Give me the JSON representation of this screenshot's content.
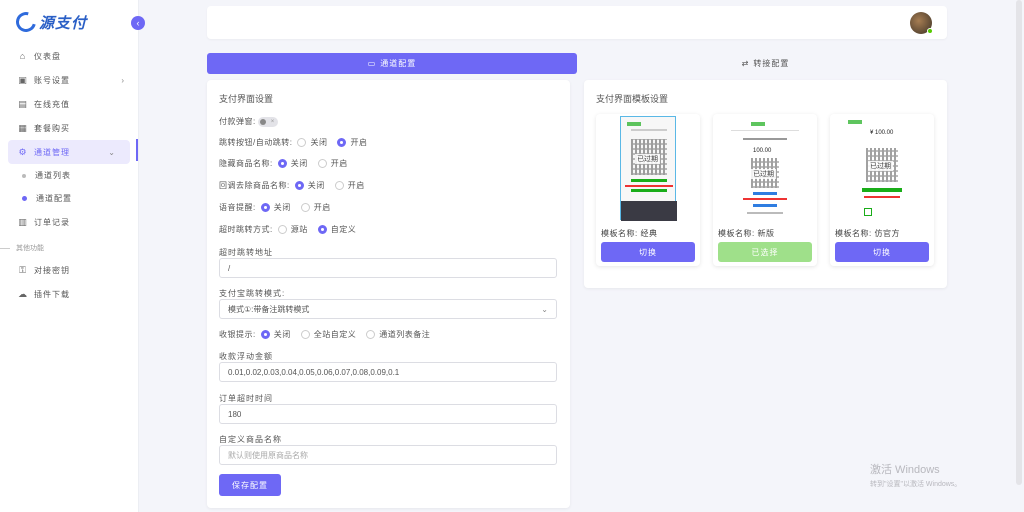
{
  "brand": {
    "logo_text": "源支付"
  },
  "sidebar": {
    "items": [
      {
        "label": "仪表盘",
        "icon": "home-icon"
      },
      {
        "label": "账号设置",
        "icon": "user-card-icon"
      },
      {
        "label": "在线充值",
        "icon": "wallet-icon"
      },
      {
        "label": "套餐购买",
        "icon": "package-icon"
      },
      {
        "label": "通道管理",
        "icon": "gear-icon"
      }
    ],
    "sub_items": [
      {
        "label": "通道列表"
      },
      {
        "label": "通道配置"
      }
    ],
    "order_item": {
      "label": "订单记录",
      "icon": "order-icon"
    },
    "group_label": "其他功能",
    "other_items": [
      {
        "label": "对接密钥",
        "icon": "key-icon"
      },
      {
        "label": "插件下载",
        "icon": "cloud-download-icon"
      }
    ]
  },
  "tabs": [
    {
      "label": "通道配置",
      "icon": "monitor-icon",
      "active": true
    },
    {
      "label": "转接配置",
      "icon": "swap-icon",
      "active": false
    }
  ],
  "payment_settings": {
    "title": "支付界面设置",
    "popup_label": "付款弹窗:",
    "jump_label": "跳转按钮/自动跳转:",
    "hide_name_label": "隐藏商品名称:",
    "callback_label": "回调去除商品名称:",
    "voice_label": "语音提醒:",
    "timeout_label": "超时跳转方式:",
    "opt_off": "关闭",
    "opt_on": "开启",
    "opt_origin": "源站",
    "opt_custom": "自定义",
    "timeout_url_label": "超时跳转地址",
    "timeout_url_value": "/",
    "alipay_mode_label": "支付宝跳转模式:",
    "alipay_mode_value": "模式①:带备注跳转模式",
    "receipt_label": "收银提示:",
    "opt_site_custom": "全站自定义",
    "opt_channel_note": "通道列表备注",
    "float_label": "收款浮动金额",
    "float_value": "0.01,0.02,0.03,0.04,0.05,0.06,0.07,0.08,0.09,0.1",
    "order_timeout_label": "订单超时时间",
    "order_timeout_value": "180",
    "custom_name_label": "自定义商品名称",
    "custom_name_placeholder": "默认则使用原商品名称",
    "save_label": "保存配置"
  },
  "templates": {
    "title": "支付界面模板设置",
    "items": [
      {
        "name": "模板名称: 经典",
        "button": "切换",
        "state": "switch",
        "stamp": "已过期"
      },
      {
        "name": "模板名称: 新版",
        "button": "已选择",
        "state": "selected",
        "stamp": "已过期",
        "amount": "100.00"
      },
      {
        "name": "模板名称: 仿官方",
        "button": "切换",
        "state": "switch",
        "stamp": "已过期",
        "amount": "¥ 100.00"
      }
    ]
  },
  "watermark": {
    "line1": "激活 Windows",
    "line2": "转到\"设置\"以激活 Windows。"
  },
  "colors": {
    "accent": "#6e68f5",
    "selected": "#9fe08a",
    "online": "#56ca00"
  }
}
